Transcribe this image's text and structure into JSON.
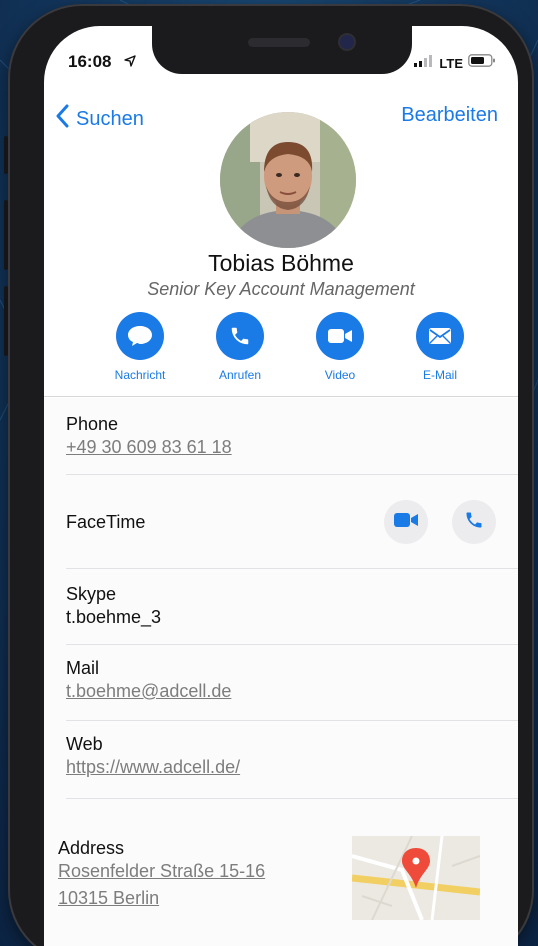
{
  "status": {
    "time": "16:08",
    "network": "LTE"
  },
  "nav": {
    "back_label": "Suchen",
    "edit_label": "Bearbeiten"
  },
  "contact": {
    "name": "Tobias Böhme",
    "title": "Senior Key Account Management"
  },
  "actions": [
    {
      "label": "Nachricht",
      "icon": "message-icon"
    },
    {
      "label": "Anrufen",
      "icon": "phone-icon"
    },
    {
      "label": "Video",
      "icon": "video-icon"
    },
    {
      "label": "E-Mail",
      "icon": "mail-icon"
    }
  ],
  "fields": {
    "phone": {
      "label": "Phone",
      "value": "+49 30 609 83 61 18"
    },
    "facetime": {
      "label": "FaceTime"
    },
    "skype": {
      "label": "Skype",
      "value": "t.boehme_3"
    },
    "mail": {
      "label": "Mail",
      "value": "t.boehme@adcell.de"
    },
    "web": {
      "label": "Web",
      "value": "https://www.adcell.de/"
    },
    "address": {
      "label": "Address",
      "line1": "Rosenfelder Straße 15-16",
      "line2": "10315 Berlin"
    }
  },
  "colors": {
    "accent": "#1a7ae6",
    "pin": "#ef4b3b"
  }
}
